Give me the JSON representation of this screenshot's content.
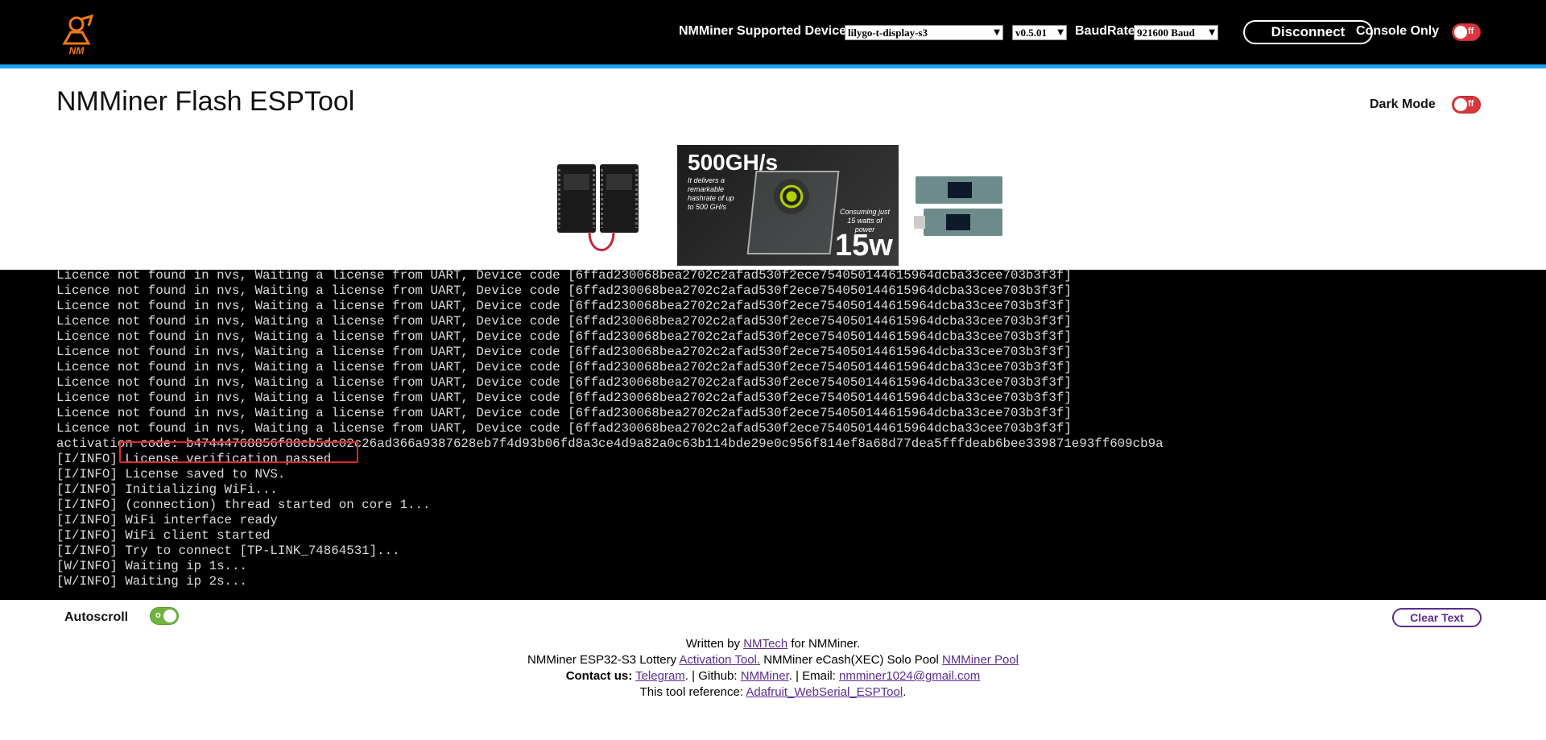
{
  "topbar": {
    "supported_devices_label": "NMMiner Supported Devices:",
    "device_select_value": "lilygo-t-display-s3",
    "version_select_value": "v0.5.01",
    "baud_label": "BaudRate:",
    "baud_select_value": "921600 Baud",
    "disconnect_label": "Disconnect",
    "console_only_label": "Console Only",
    "console_only_toggle_text": "ff",
    "logo_text": "NM"
  },
  "header": {
    "title": "NMMiner Flash ESPTool",
    "dark_mode_label": "Dark Mode",
    "dark_mode_toggle_text": "ff"
  },
  "banner": {
    "promo_headline": "500GH/s",
    "promo_sub": "It delivers a remarkable hashrate of up to 500 GH/s",
    "promo_consumption": "Consuming just 15 watts of power",
    "promo_watts": "15w"
  },
  "console": {
    "lines": [
      "Licence not found in nvs, Waiting a license from UART, Device code [6ffad230068bea2702c2afad530f2ece754050144615964dcba33cee703b3f3f]",
      "Licence not found in nvs, Waiting a license from UART, Device code [6ffad230068bea2702c2afad530f2ece754050144615964dcba33cee703b3f3f]",
      "Licence not found in nvs, Waiting a license from UART, Device code [6ffad230068bea2702c2afad530f2ece754050144615964dcba33cee703b3f3f]",
      "Licence not found in nvs, Waiting a license from UART, Device code [6ffad230068bea2702c2afad530f2ece754050144615964dcba33cee703b3f3f]",
      "Licence not found in nvs, Waiting a license from UART, Device code [6ffad230068bea2702c2afad530f2ece754050144615964dcba33cee703b3f3f]",
      "Licence not found in nvs, Waiting a license from UART, Device code [6ffad230068bea2702c2afad530f2ece754050144615964dcba33cee703b3f3f]",
      "Licence not found in nvs, Waiting a license from UART, Device code [6ffad230068bea2702c2afad530f2ece754050144615964dcba33cee703b3f3f]",
      "Licence not found in nvs, Waiting a license from UART, Device code [6ffad230068bea2702c2afad530f2ece754050144615964dcba33cee703b3f3f]",
      "Licence not found in nvs, Waiting a license from UART, Device code [6ffad230068bea2702c2afad530f2ece754050144615964dcba33cee703b3f3f]",
      "Licence not found in nvs, Waiting a license from UART, Device code [6ffad230068bea2702c2afad530f2ece754050144615964dcba33cee703b3f3f]",
      "activation code: b47444768856f88cb5dc02c26ad366a9387628eb7f4d93b06fd8a3ce4d9a82a0c63b114bde29e0c956f814ef8a68d77dea5fffdeab6bee339871e93ff609cb9a",
      "[I/INFO] License verification passed",
      "[I/INFO] License saved to NVS.",
      "[I/INFO] Initializing WiFi...",
      "[I/INFO] (connection) thread started on core 1...",
      "[I/INFO] WiFi interface ready",
      "[I/INFO] WiFi client started",
      "[I/INFO] Try to connect [TP-LINK_74864531]...",
      "[W/INFO] Waiting ip 1s...",
      "[W/INFO] Waiting ip 2s..."
    ]
  },
  "controls": {
    "autoscroll_label": "Autoscroll",
    "autoscroll_toggle_text": "o",
    "clear_text_label": "Clear Text"
  },
  "footer": {
    "line1_prefix": "Written by ",
    "line1_link": "NMTech",
    "line1_suffix": " for NMMiner.",
    "line2_prefix": "NMMiner ESP32-S3 Lottery ",
    "line2_link1": "Activation Tool.",
    "line2_mid": " NMMiner eCash(XEC) Solo Pool ",
    "line2_link2": "NMMiner Pool",
    "line3_contact": "Contact us:",
    "line3_telegram": "Telegram",
    "line3_sep1": ". | Github: ",
    "line3_github": "NMMiner",
    "line3_sep2": ". | Email: ",
    "line3_email": "nmminer1024@gmail.com",
    "line4_prefix": "This tool reference: ",
    "line4_link": "Adafruit_WebSerial_ESPTool",
    "line4_suffix": "."
  },
  "colors": {
    "accent_blue": "#1ea1f2",
    "toggle_off": "#d9363e",
    "toggle_on": "#6fb43f",
    "link_purple": "#5b2d8e",
    "highlight_red": "#e0262b"
  }
}
